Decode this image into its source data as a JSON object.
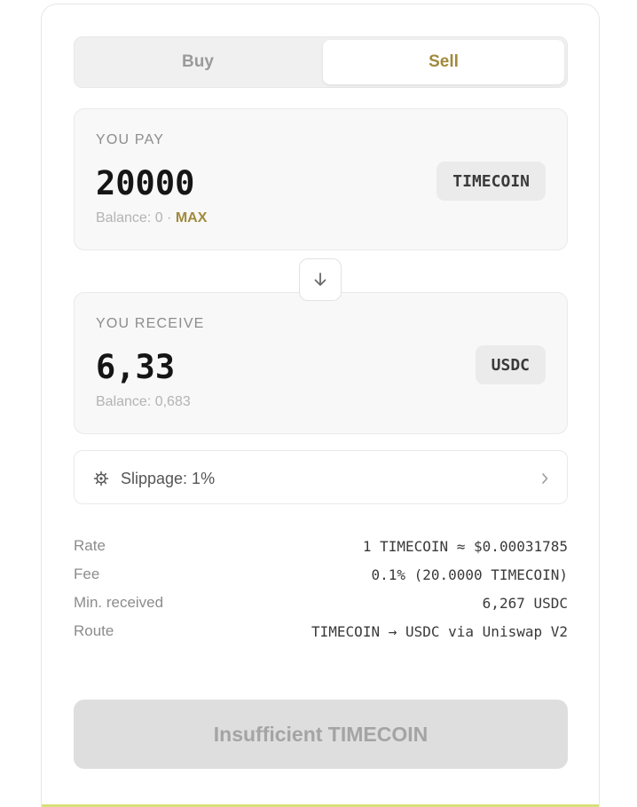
{
  "tabs": {
    "buy_label": "Buy",
    "sell_label": "Sell",
    "active": "sell"
  },
  "pay": {
    "label": "YOU PAY",
    "amount": "20000",
    "token": "TIMECOIN",
    "balance_text": "Balance: 0 · ",
    "max_label": "MAX"
  },
  "receive": {
    "label": "YOU RECEIVE",
    "amount": "6,33",
    "token": "USDC",
    "balance_text": "Balance: 0,683"
  },
  "direction_icon": "arrow-down-icon",
  "slippage": {
    "icon": "gear-icon",
    "label": "Slippage: 1%"
  },
  "details": [
    {
      "key": "Rate",
      "value": "1 TIMECOIN ≈ $0.00031785"
    },
    {
      "key": "Fee",
      "value": "0.1% (20.0000 TIMECOIN)"
    },
    {
      "key": "Min. received",
      "value": "6,267 USDC"
    },
    {
      "key": "Route",
      "value": "TIMECOIN → USDC via Uniswap V2"
    }
  ],
  "cta": {
    "label": "Insufficient TIMECOIN",
    "enabled": false
  },
  "colors": {
    "accent": "#a08a3c",
    "panel_bg": "#f8f8f8",
    "cta_disabled_bg": "#dedede",
    "bottom_accent": "#d9e07a"
  }
}
